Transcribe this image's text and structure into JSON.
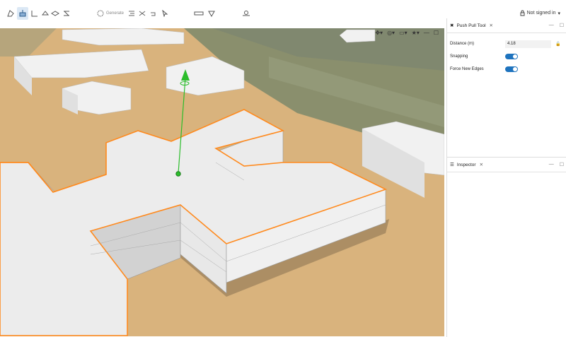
{
  "toolbar": {
    "generate_label": "Generate",
    "status_text": "Not signed in"
  },
  "push_pull_panel": {
    "title": "Push Pull Tool",
    "distance_label": "Distance (m)",
    "distance_value": "4.18",
    "snapping_label": "Snapping",
    "snapping_on": true,
    "force_edges_label": "Force New Edges",
    "force_edges_on": true
  },
  "inspector_panel": {
    "title": "Inspector"
  },
  "colors": {
    "accent": "#1e73be",
    "selection": "#ff8a1e",
    "gizmo": "#2bbd2b",
    "ground": "#d9b37d"
  }
}
